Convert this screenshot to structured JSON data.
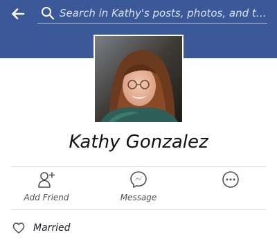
{
  "header": {
    "back_icon": "back-arrow-icon",
    "search": {
      "icon": "search-icon",
      "placeholder": "Search in Kathy's posts, photos, and t…"
    },
    "bar_color": "#3b5998"
  },
  "profile": {
    "name": "Kathy Gonzalez",
    "photo": "profile-photo"
  },
  "actions": [
    {
      "label": "Add Friend",
      "icon": "add-friend-icon"
    },
    {
      "label": "Message",
      "icon": "messenger-icon"
    },
    {
      "label": "",
      "icon": "more-icon"
    }
  ],
  "intro": [
    {
      "label": "Married",
      "icon": "heart-outline-icon"
    }
  ],
  "colors": {
    "accent": "#3b5998",
    "text": "#1d2129",
    "secondary_text": "#4b4f56",
    "divider": "#dcdee3"
  }
}
